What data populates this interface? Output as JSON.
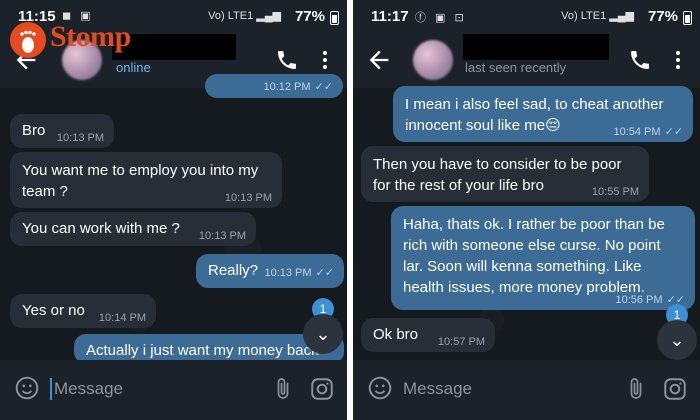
{
  "brand": {
    "logo_text": "Stomp"
  },
  "left": {
    "status_bar": {
      "time": "11:15",
      "battery": "77%",
      "signal": "Vo) LTE1"
    },
    "header": {
      "status": "online"
    },
    "messages": [
      {
        "dir": "out",
        "text": "",
        "time": "10:12 PM"
      },
      {
        "dir": "in",
        "text": "Bro",
        "time": "10:13 PM"
      },
      {
        "dir": "in",
        "text": "You want me to employ you into my team ?",
        "time": "10:13 PM"
      },
      {
        "dir": "in",
        "text": "You can work with me ?",
        "time": "10:13 PM"
      },
      {
        "dir": "out",
        "text": "Really?",
        "time": "10:13 PM"
      },
      {
        "dir": "in",
        "text": "Yes or no",
        "time": "10:14 PM"
      },
      {
        "dir": "out",
        "text": "Actually i just want my money back",
        "time": ""
      }
    ],
    "unread_count": "1",
    "input": {
      "placeholder": "Message"
    }
  },
  "right": {
    "status_bar": {
      "time": "11:17",
      "battery": "77%",
      "signal": "Vo) LTE1"
    },
    "header": {
      "status": "last seen recently"
    },
    "messages": [
      {
        "dir": "out",
        "text": "I mean i also feel sad, to cheat another innocent soul like me😔",
        "time": "10:54 PM"
      },
      {
        "dir": "in",
        "text": "Then you have to consider to be poor for the rest of your life bro",
        "time": "10:55 PM"
      },
      {
        "dir": "out",
        "text": "Haha, thats ok. I rather be poor than be rich with someone else curse. No point lar. Soon will kenna something. Like health issues, more money problem.",
        "time": "10:56 PM"
      },
      {
        "dir": "in",
        "text": "Ok bro",
        "time": "10:57 PM"
      }
    ],
    "unread_count": "1",
    "input": {
      "placeholder": "Message"
    }
  },
  "colors": {
    "incoming": "#272e37",
    "outgoing": "#3c6c96",
    "accent": "#3d8fd6",
    "online": "#6fb4e8",
    "brand": "#e64a1f"
  }
}
